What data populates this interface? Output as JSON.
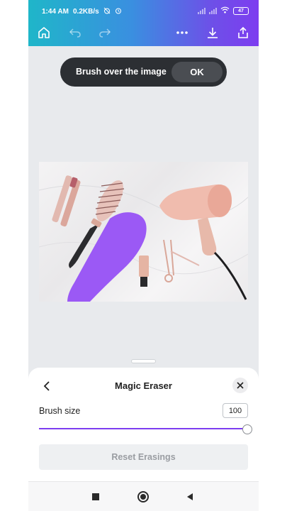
{
  "status_bar": {
    "time": "1:44 AM",
    "speed": "0.2KB/s",
    "battery": "47"
  },
  "toolbar": {
    "icons": [
      "home-icon",
      "undo-icon",
      "redo-icon",
      "more-icon",
      "download-icon",
      "share-icon"
    ]
  },
  "toast": {
    "message": "Brush over the image",
    "ok_label": "OK"
  },
  "sheet": {
    "title": "Magic Eraser",
    "brush_size_label": "Brush size",
    "brush_size_value": "100",
    "brush_size_fraction": 1.0,
    "reset_label": "Reset Erasings"
  },
  "colors": {
    "accent": "#7d3df0",
    "header_start": "#1fb6c9",
    "header_end": "#7d3df0",
    "brush_overlay": "#9b59f5"
  }
}
